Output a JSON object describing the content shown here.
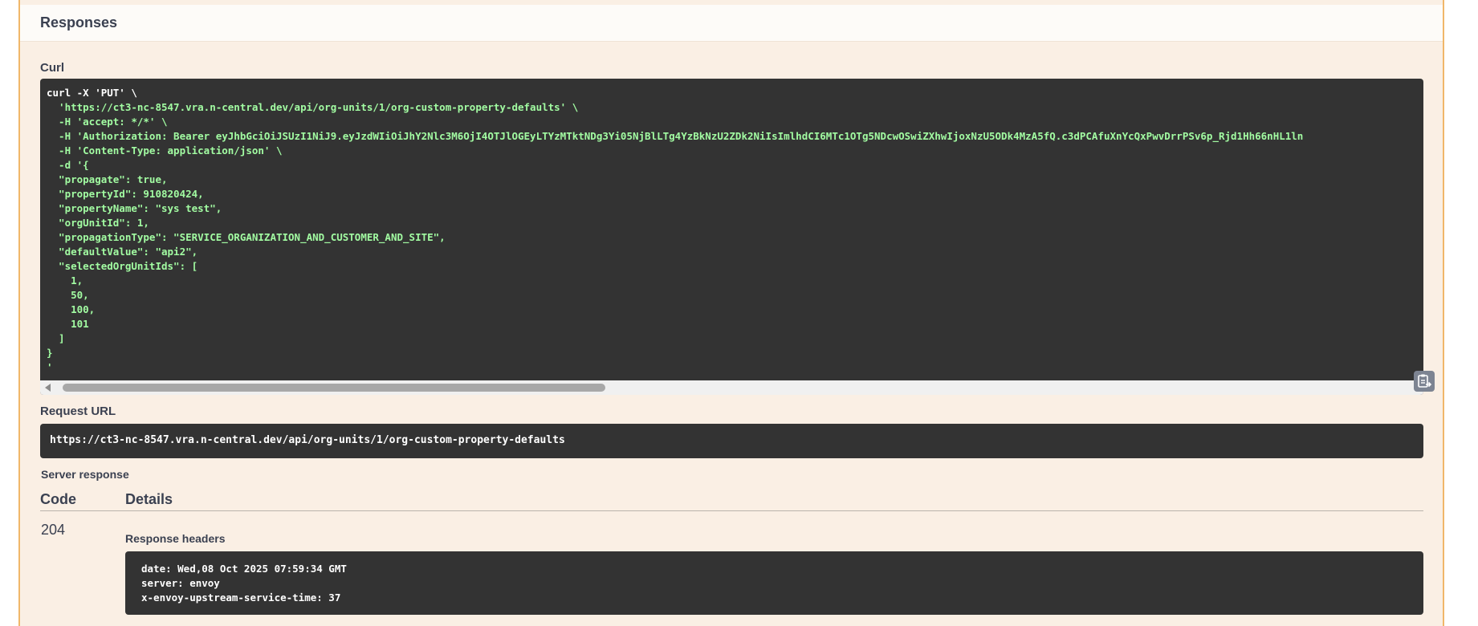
{
  "responses": {
    "title": "Responses",
    "curl_label": "Curl",
    "curl_lines": [
      "curl -X 'PUT' \\",
      "  'https://ct3-nc-8547.vra.n-central.dev/api/org-units/1/org-custom-property-defaults' \\",
      "  -H 'accept: */*' \\",
      "  -H 'Authorization: Bearer eyJhbGciOiJSUzI1NiJ9.eyJzdWIiOiJhY2Nlc3M6OjI4OTJlOGEyLTYzMTktNDg3Yi05NjBlLTg4YzBkNzU2ZDk2NiIsImlhdCI6MTc1OTg5NDcwOSwiZXhwIjoxNzU5ODk4MzA5fQ.c3dPCAfuXnYcQxPwvDrrPSv6p_Rjd1Hh66nHL1ln",
      "  -H 'Content-Type: application/json' \\",
      "  -d '{",
      "  \"propagate\": true,",
      "  \"propertyId\": 910820424,",
      "  \"propertyName\": \"sys test\",",
      "  \"orgUnitId\": 1,",
      "  \"propagationType\": \"SERVICE_ORGANIZATION_AND_CUSTOMER_AND_SITE\",",
      "  \"defaultValue\": \"api2\",",
      "  \"selectedOrgUnitIds\": [",
      "    1,",
      "    50,",
      "    100,",
      "    101",
      "  ]",
      "}",
      "'"
    ],
    "request_url_label": "Request URL",
    "request_url": "https://ct3-nc-8547.vra.n-central.dev/api/org-units/1/org-custom-property-defaults",
    "server_response_label": "Server response",
    "code_header": "Code",
    "details_header": "Details",
    "status_code": "204",
    "response_headers_label": "Response headers",
    "response_headers": [
      "date: Wed,08 Oct 2025 07:59:34 GMT",
      "server: envoy",
      "x-envoy-upstream-service-time: 37"
    ]
  },
  "icons": {
    "copy": "clipboard-copy-icon",
    "scroll_left": "scroll-left-arrow-icon"
  },
  "colors": {
    "panel_bg": "#faefe4",
    "panel_border": "#f0b76a",
    "code_bg": "#333333",
    "code_string": "#a2fca2"
  }
}
